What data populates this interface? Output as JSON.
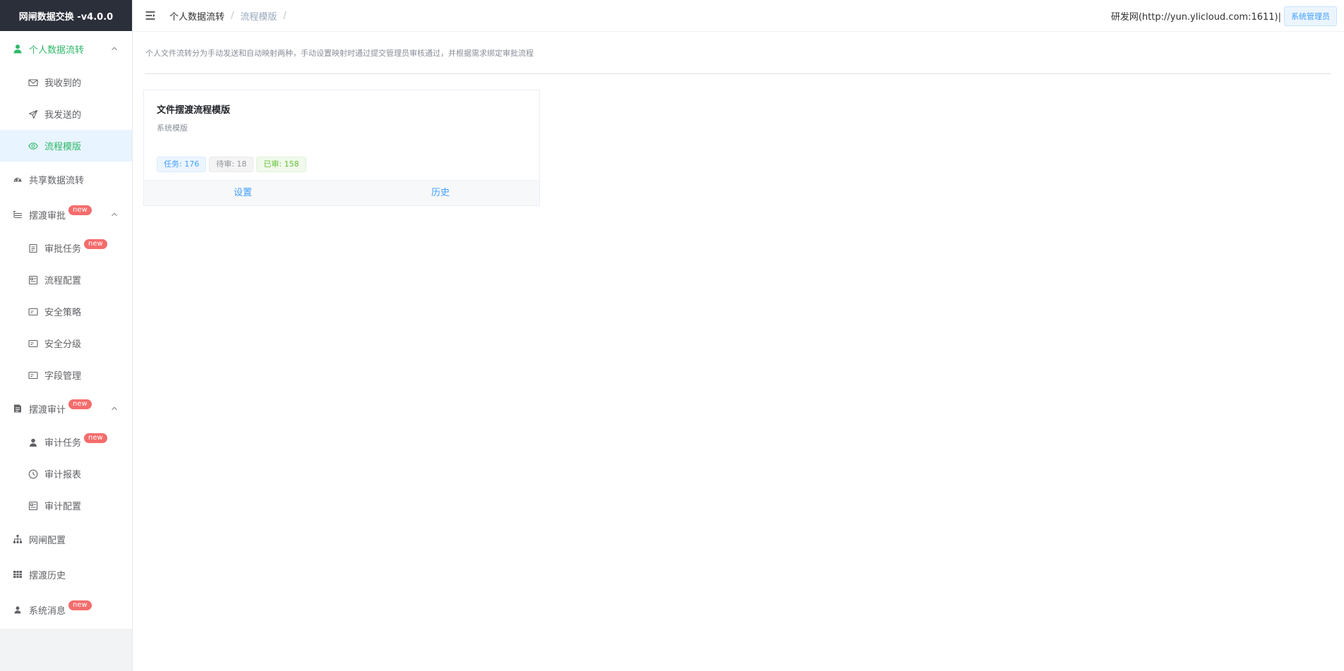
{
  "app": {
    "title": "网闸数据交换 -v4.0.0"
  },
  "colors": {
    "accent": "#2fb868",
    "link": "#409eff",
    "badge": "#f56c6c",
    "logo_bg": "#2b2f3a"
  },
  "sidebar": {
    "personal": {
      "label": "个人数据流转",
      "icon": "user-icon",
      "expanded": true,
      "items": [
        {
          "label": "我收到的",
          "icon": "envelope-icon"
        },
        {
          "label": "我发送的",
          "icon": "send-icon"
        },
        {
          "label": "流程模版",
          "icon": "eye-icon",
          "active": true
        }
      ]
    },
    "shared": {
      "label": "共享数据流转",
      "icon": "dashboard-icon"
    },
    "approval": {
      "label": "摆渡审批",
      "badge": "new",
      "icon": "tree-list-icon",
      "expanded": true,
      "items": [
        {
          "label": "审批任务",
          "icon": "document-icon",
          "badge": "new"
        },
        {
          "label": "流程配置",
          "icon": "form-icon"
        },
        {
          "label": "安全策略",
          "icon": "card-icon"
        },
        {
          "label": "安全分级",
          "icon": "card-icon"
        },
        {
          "label": "字段管理",
          "icon": "card-icon"
        }
      ]
    },
    "audit": {
      "label": "摆渡审计",
      "badge": "new",
      "icon": "report-icon",
      "expanded": true,
      "items": [
        {
          "label": "审计任务",
          "icon": "person-icon",
          "badge": "new"
        },
        {
          "label": "审计报表",
          "icon": "clock-icon"
        },
        {
          "label": "审计配置",
          "icon": "form-icon"
        }
      ]
    },
    "gateway": {
      "label": "网闸配置",
      "icon": "org-chart-icon"
    },
    "history": {
      "label": "摆渡历史",
      "icon": "table-icon"
    },
    "messages": {
      "label": "系统消息",
      "badge": "new",
      "icon": "person-icon"
    }
  },
  "header": {
    "breadcrumb": [
      "个人数据流转",
      "流程模版"
    ],
    "server": "研发网(http://yun.ylicloud.com:1611)|",
    "role": "系统管理员"
  },
  "main": {
    "description": "个人文件流转分为手动发送和自动映射两种，手动设置映射时通过提交管理员审核通过，并根据需求绑定审批流程",
    "card": {
      "title": "文件摆渡流程模版",
      "subtitle": "系统模版",
      "tags": {
        "tasks": "任务: 176",
        "pending": "待审: 18",
        "approved": "已审: 158"
      },
      "actions": {
        "settings": "设置",
        "history": "历史"
      }
    }
  }
}
